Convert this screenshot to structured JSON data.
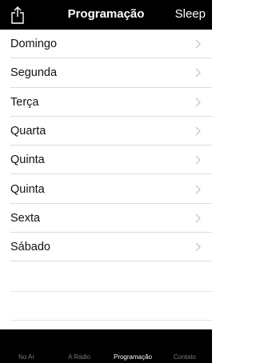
{
  "navbar": {
    "title": "Programação",
    "sleep_label": "Sleep",
    "share_icon": "share-icon"
  },
  "schedule": {
    "items": [
      {
        "label": "Domingo"
      },
      {
        "label": "Segunda"
      },
      {
        "label": "Terça"
      },
      {
        "label": "Quarta"
      },
      {
        "label": "Quinta"
      },
      {
        "label": "Quinta"
      },
      {
        "label": "Sexta"
      },
      {
        "label": "Sábado"
      }
    ],
    "chevron_icon": "chevron-right-icon"
  },
  "tabbar": {
    "tabs": [
      {
        "label": "No Ar",
        "active": false
      },
      {
        "label": "A Rádio",
        "active": false
      },
      {
        "label": "Programação",
        "active": true
      },
      {
        "label": "Contato",
        "active": false
      }
    ]
  },
  "colors": {
    "bar_background": "#000000",
    "tab_active": "#ffffff",
    "tab_inactive": "#7a7a7a",
    "separator": "#dcdcdc",
    "chevron": "#c7c7cc"
  }
}
